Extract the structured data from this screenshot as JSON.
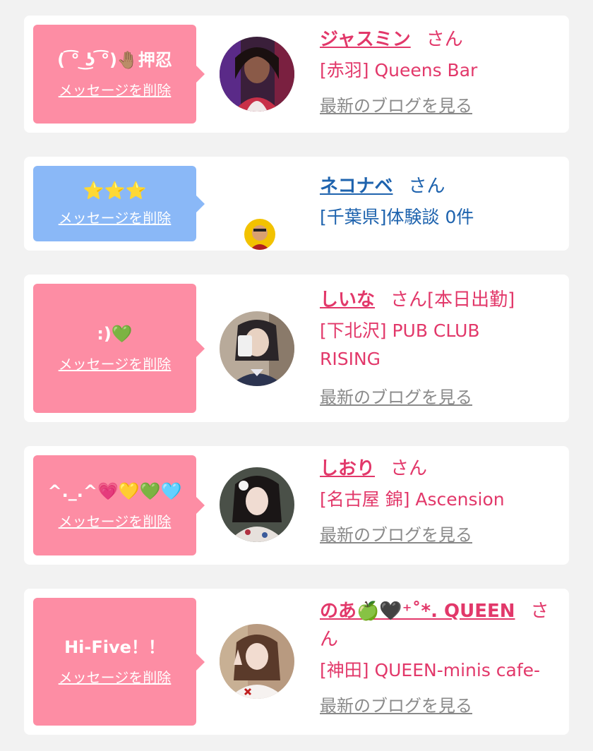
{
  "colors": {
    "pink_bubble": "#fd8da4",
    "blue_bubble": "#8ab8f7",
    "pink_text": "#e2386a",
    "blue_text": "#1e63ae",
    "gray_link": "#8a8a8a"
  },
  "cards": [
    {
      "message": "( ͡° ͜ʖ ͡°)🤚🏽押忍",
      "delete_label": "メッセージを削除",
      "name": "ジャスミン",
      "honorific": "さん",
      "status": "",
      "detail": "[赤羽] Queens Bar",
      "blog_label": "最新のブログを見る"
    },
    {
      "message": "⭐⭐⭐",
      "delete_label": "メッセージを削除",
      "name": "ネコナベ",
      "honorific": "さん",
      "detail": "[千葉県]体験談 0件"
    },
    {
      "message": ":)💚",
      "delete_label": "メッセージを削除",
      "name": "しいな",
      "honorific": "さん",
      "status": "[本日出勤]",
      "detail": "[下北沢] PUB CLUB RISING",
      "blog_label": "最新のブログを見る"
    },
    {
      "message": "^._.^💗💛💚🩵",
      "delete_label": "メッセージを削除",
      "name": "しおり",
      "honorific": "さん",
      "status": "",
      "detail": "[名古屋 錦] Ascension",
      "blog_label": "最新のブログを見る"
    },
    {
      "message": "Hi-Five！！",
      "delete_label": "メッセージを削除",
      "name": "のあ🍏🖤⁺˚*. QUEEN",
      "honorific": "さん",
      "status": "",
      "detail": "[神田] QUEEN-minis cafe-",
      "blog_label": "最新のブログを見る"
    }
  ]
}
